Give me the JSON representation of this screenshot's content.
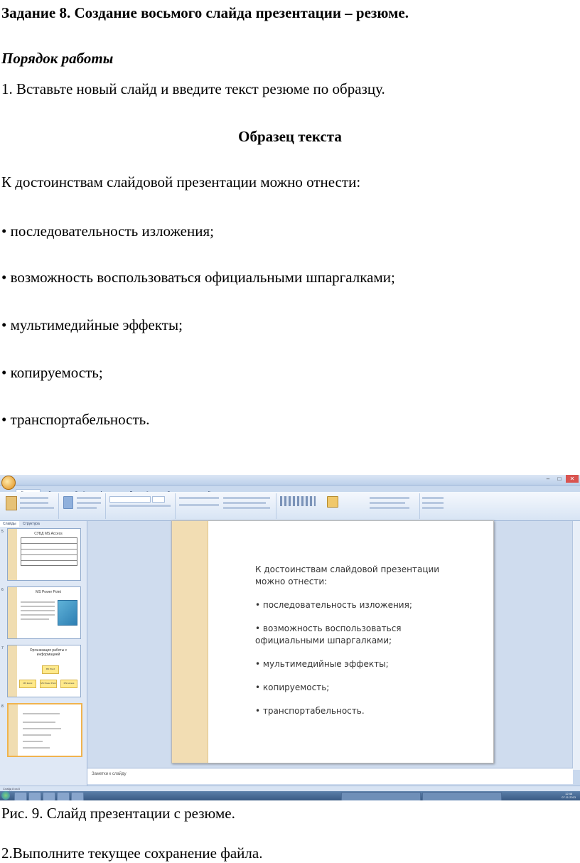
{
  "task_heading": "Задание 8. Создание восьмого слайда презентации – резюме.",
  "procedure_heading": "Порядок работы",
  "step1": "1. Вставьте новый слайд и введите текст резюме по образцу.",
  "sample_heading": "Образец текста",
  "intro": "К достоинствам слайдовой презентации можно отнести:",
  "bullets": [
    "• последовательность изложения;",
    "• возможность воспользоваться официальными шпаргалками;",
    "• мультимедийные эффекты;",
    "• копируемость;",
    "• транспортабельность."
  ],
  "caption": "Рис. 9. Слайд презентации с резюме.",
  "step2": "2.Выполните текущее сохранение файла.",
  "screenshot": {
    "ribbon_tabs": [
      "Главная",
      "Вставка",
      "Дизайн",
      "Анимация",
      "Показ слайдов",
      "Рецензирование",
      "Вид"
    ],
    "panel_tabs": [
      "Слайды",
      "Структура"
    ],
    "thumbnails": [
      {
        "num": "5",
        "title": "СУБД MS Access"
      },
      {
        "num": "6",
        "title": "MS Power Point"
      },
      {
        "num": "7",
        "title": "Организация работы с информацией",
        "boxes": [
          "MS Word",
          "MS Excel",
          "MS Power Point",
          "MS Access"
        ]
      },
      {
        "num": "8",
        "title": ""
      }
    ],
    "slide_lines": [
      "К достоинствам слайдовой презентации",
      "можно отнести:",
      "• последовательность изложения;",
      "• возможность воспользоваться",
      "официальными шпаргалками;",
      "• мультимедийные эффекты;",
      "• копируемость;",
      "• транспортабельность."
    ],
    "notes_placeholder": "Заметки к слайду",
    "status_left": "Слайд 8 из 8",
    "clock_time": "12:46",
    "clock_date": "07.11.2013"
  }
}
